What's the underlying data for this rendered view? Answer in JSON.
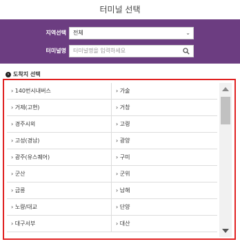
{
  "title": "터미널 선택",
  "form": {
    "region_label": "지역선택",
    "region_value": "전체",
    "terminal_label": "터미널명",
    "terminal_placeholder": "터미널명을 입력하세요"
  },
  "section": {
    "title": "도착지 선택"
  },
  "terminals": [
    {
      "left": "140번시내버스",
      "right": "가술"
    },
    {
      "left": "거제(고현)",
      "right": "거창"
    },
    {
      "left": "경주시외",
      "right": "고령"
    },
    {
      "left": "고성(경남)",
      "right": "광양"
    },
    {
      "left": "광주(유스퀘어)",
      "right": "구미"
    },
    {
      "left": "군산",
      "right": "군위"
    },
    {
      "left": "금릉",
      "right": "남해"
    },
    {
      "left": "노량/대교",
      "right": "단양"
    },
    {
      "left": "대구서부",
      "right": "대산"
    }
  ],
  "colors": {
    "header_bg": "#6c3d81",
    "highlight_border": "#e02020"
  }
}
